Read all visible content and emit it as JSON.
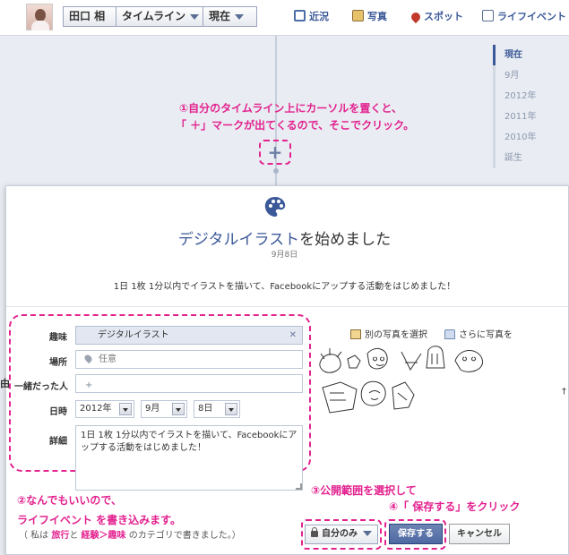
{
  "header": {
    "name": "田口 相",
    "timeline_label": "タイムライン",
    "now_label": "現在",
    "nav": {
      "recent": "近況",
      "photos": "写真",
      "places": "スポット",
      "life_event": "ライフイベント"
    }
  },
  "year_nav": [
    "現在",
    "9月",
    "2012年",
    "2011年",
    "2010年",
    "誕生"
  ],
  "annotations": {
    "step1_line1": "①自分のタイムライン上にカーソルを置くと、",
    "step1_line2": "「 ＋」マークが出てくるので、そこでクリック。",
    "step2_line1": "②なんでもいいので、",
    "step2_line2": "ライフイベント を書き込みます。",
    "step2_note_open": "（ 私は ",
    "step2_note_hl1": "旅行",
    "step2_note_and": "と ",
    "step2_note_hl2": "経験＞趣味",
    "step2_note_close": " のカテゴリで書きました。）",
    "step3": "③公開範囲を選択して",
    "step4": "④「 保存する」をクリック"
  },
  "plus_icon": "+",
  "event": {
    "title_link": "デジタルイラスト",
    "title_suffix": "を始めました",
    "date": "9月8日",
    "description": "1日 1枚 1分以内でイラストを描いて、Facebookにアップする活動をはじめました！"
  },
  "form": {
    "interest_label": "趣味",
    "interest_value": "デジタルイラスト",
    "interest_clear": "✕",
    "place_label": "場所",
    "place_placeholder": "任意",
    "with_label": "一緒だった人",
    "with_icon": "+",
    "date_label": "日時",
    "year_value": "2012年",
    "month_value": "9月",
    "day_value": "8日",
    "detail_label": "詳細",
    "detail_value": "1日 1枚 1分以内でイラストを描いて、Facebookにアップする活動をはじめました！"
  },
  "photos": {
    "choose_other": "別の写真を選択",
    "add_more": "さらに写真を"
  },
  "edge": {
    "left": "由",
    "right": "†"
  },
  "footer": {
    "privacy": "自分のみ",
    "save": "保存する",
    "cancel": "キャンセル"
  },
  "colors": {
    "accent": "#3b5998",
    "annotation": "#e3228f"
  }
}
